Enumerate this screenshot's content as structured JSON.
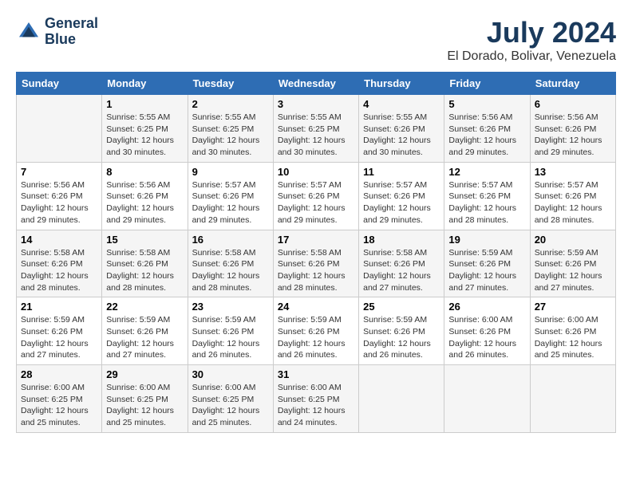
{
  "logo": {
    "line1": "General",
    "line2": "Blue"
  },
  "title": "July 2024",
  "location": "El Dorado, Bolivar, Venezuela",
  "days_of_week": [
    "Sunday",
    "Monday",
    "Tuesday",
    "Wednesday",
    "Thursday",
    "Friday",
    "Saturday"
  ],
  "weeks": [
    [
      {
        "num": "",
        "info": ""
      },
      {
        "num": "1",
        "info": "Sunrise: 5:55 AM\nSunset: 6:25 PM\nDaylight: 12 hours\nand 30 minutes."
      },
      {
        "num": "2",
        "info": "Sunrise: 5:55 AM\nSunset: 6:25 PM\nDaylight: 12 hours\nand 30 minutes."
      },
      {
        "num": "3",
        "info": "Sunrise: 5:55 AM\nSunset: 6:25 PM\nDaylight: 12 hours\nand 30 minutes."
      },
      {
        "num": "4",
        "info": "Sunrise: 5:55 AM\nSunset: 6:26 PM\nDaylight: 12 hours\nand 30 minutes."
      },
      {
        "num": "5",
        "info": "Sunrise: 5:56 AM\nSunset: 6:26 PM\nDaylight: 12 hours\nand 29 minutes."
      },
      {
        "num": "6",
        "info": "Sunrise: 5:56 AM\nSunset: 6:26 PM\nDaylight: 12 hours\nand 29 minutes."
      }
    ],
    [
      {
        "num": "7",
        "info": "Sunrise: 5:56 AM\nSunset: 6:26 PM\nDaylight: 12 hours\nand 29 minutes."
      },
      {
        "num": "8",
        "info": "Sunrise: 5:56 AM\nSunset: 6:26 PM\nDaylight: 12 hours\nand 29 minutes."
      },
      {
        "num": "9",
        "info": "Sunrise: 5:57 AM\nSunset: 6:26 PM\nDaylight: 12 hours\nand 29 minutes."
      },
      {
        "num": "10",
        "info": "Sunrise: 5:57 AM\nSunset: 6:26 PM\nDaylight: 12 hours\nand 29 minutes."
      },
      {
        "num": "11",
        "info": "Sunrise: 5:57 AM\nSunset: 6:26 PM\nDaylight: 12 hours\nand 29 minutes."
      },
      {
        "num": "12",
        "info": "Sunrise: 5:57 AM\nSunset: 6:26 PM\nDaylight: 12 hours\nand 28 minutes."
      },
      {
        "num": "13",
        "info": "Sunrise: 5:57 AM\nSunset: 6:26 PM\nDaylight: 12 hours\nand 28 minutes."
      }
    ],
    [
      {
        "num": "14",
        "info": "Sunrise: 5:58 AM\nSunset: 6:26 PM\nDaylight: 12 hours\nand 28 minutes."
      },
      {
        "num": "15",
        "info": "Sunrise: 5:58 AM\nSunset: 6:26 PM\nDaylight: 12 hours\nand 28 minutes."
      },
      {
        "num": "16",
        "info": "Sunrise: 5:58 AM\nSunset: 6:26 PM\nDaylight: 12 hours\nand 28 minutes."
      },
      {
        "num": "17",
        "info": "Sunrise: 5:58 AM\nSunset: 6:26 PM\nDaylight: 12 hours\nand 28 minutes."
      },
      {
        "num": "18",
        "info": "Sunrise: 5:58 AM\nSunset: 6:26 PM\nDaylight: 12 hours\nand 27 minutes."
      },
      {
        "num": "19",
        "info": "Sunrise: 5:59 AM\nSunset: 6:26 PM\nDaylight: 12 hours\nand 27 minutes."
      },
      {
        "num": "20",
        "info": "Sunrise: 5:59 AM\nSunset: 6:26 PM\nDaylight: 12 hours\nand 27 minutes."
      }
    ],
    [
      {
        "num": "21",
        "info": "Sunrise: 5:59 AM\nSunset: 6:26 PM\nDaylight: 12 hours\nand 27 minutes."
      },
      {
        "num": "22",
        "info": "Sunrise: 5:59 AM\nSunset: 6:26 PM\nDaylight: 12 hours\nand 27 minutes."
      },
      {
        "num": "23",
        "info": "Sunrise: 5:59 AM\nSunset: 6:26 PM\nDaylight: 12 hours\nand 26 minutes."
      },
      {
        "num": "24",
        "info": "Sunrise: 5:59 AM\nSunset: 6:26 PM\nDaylight: 12 hours\nand 26 minutes."
      },
      {
        "num": "25",
        "info": "Sunrise: 5:59 AM\nSunset: 6:26 PM\nDaylight: 12 hours\nand 26 minutes."
      },
      {
        "num": "26",
        "info": "Sunrise: 6:00 AM\nSunset: 6:26 PM\nDaylight: 12 hours\nand 26 minutes."
      },
      {
        "num": "27",
        "info": "Sunrise: 6:00 AM\nSunset: 6:26 PM\nDaylight: 12 hours\nand 25 minutes."
      }
    ],
    [
      {
        "num": "28",
        "info": "Sunrise: 6:00 AM\nSunset: 6:25 PM\nDaylight: 12 hours\nand 25 minutes."
      },
      {
        "num": "29",
        "info": "Sunrise: 6:00 AM\nSunset: 6:25 PM\nDaylight: 12 hours\nand 25 minutes."
      },
      {
        "num": "30",
        "info": "Sunrise: 6:00 AM\nSunset: 6:25 PM\nDaylight: 12 hours\nand 25 minutes."
      },
      {
        "num": "31",
        "info": "Sunrise: 6:00 AM\nSunset: 6:25 PM\nDaylight: 12 hours\nand 24 minutes."
      },
      {
        "num": "",
        "info": ""
      },
      {
        "num": "",
        "info": ""
      },
      {
        "num": "",
        "info": ""
      }
    ]
  ]
}
